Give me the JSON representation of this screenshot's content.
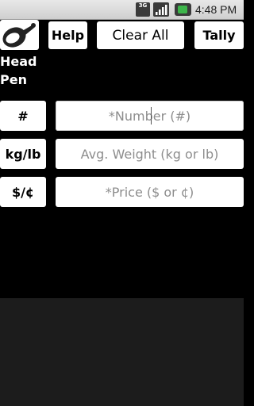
{
  "status_bar": {
    "network_type": "3G",
    "time": "4:48 PM",
    "icons": [
      "3g-icon",
      "signal-icon",
      "battery-charging-icon"
    ]
  },
  "toolbar": {
    "app_icon": "ham-icon",
    "help_label": "Help",
    "clear_all_label": "Clear All",
    "tally_label": "Tally"
  },
  "pen": {
    "line1": "Head",
    "line2": "Pen"
  },
  "rows": [
    {
      "unit_label": "#",
      "placeholder": "*Number (#)"
    },
    {
      "unit_label": "kg/lb",
      "placeholder": "Avg. Weight (kg or lb)"
    },
    {
      "unit_label": "$/¢",
      "placeholder": "*Price ($ or ¢)"
    }
  ],
  "colors": {
    "background": "#000000",
    "button": "#ffffff",
    "placeholder_text": "#8d8d8d",
    "lower_panel": "#1c1c1c"
  }
}
